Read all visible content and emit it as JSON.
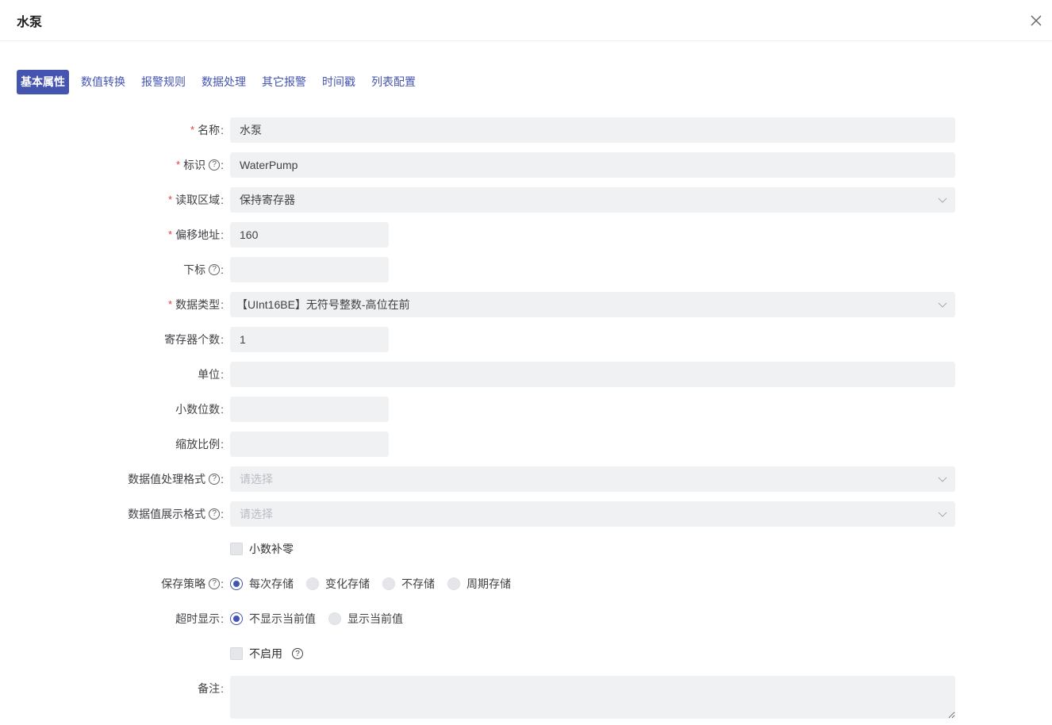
{
  "header": {
    "title": "水泵"
  },
  "tabs": [
    {
      "label": "基本属性",
      "active": true
    },
    {
      "label": "数值转换"
    },
    {
      "label": "报警规则"
    },
    {
      "label": "数据处理"
    },
    {
      "label": "其它报警"
    },
    {
      "label": "时间戳"
    },
    {
      "label": "列表配置"
    }
  ],
  "form": {
    "name": {
      "label": "名称",
      "value": "水泵"
    },
    "identifier": {
      "label": "标识",
      "value": "WaterPump"
    },
    "read_area": {
      "label": "读取区域",
      "value": "保持寄存器"
    },
    "offset": {
      "label": "偏移地址",
      "value": "160"
    },
    "index": {
      "label": "下标",
      "value": ""
    },
    "data_type": {
      "label": "数据类型",
      "value": "【UInt16BE】无符号整数-高位在前"
    },
    "register_count": {
      "label": "寄存器个数",
      "value": "1"
    },
    "unit": {
      "label": "单位",
      "value": ""
    },
    "decimals": {
      "label": "小数位数",
      "value": ""
    },
    "scale": {
      "label": "缩放比例",
      "value": ""
    },
    "process_format": {
      "label": "数据值处理格式",
      "placeholder": "请选择"
    },
    "display_format": {
      "label": "数据值展示格式",
      "placeholder": "请选择"
    },
    "zero_pad": {
      "label": "小数补零"
    },
    "save_strategy": {
      "label": "保存策略",
      "options": [
        "每次存储",
        "变化存储",
        "不存储",
        "周期存储"
      ]
    },
    "timeout_display": {
      "label": "超时显示",
      "options": [
        "不显示当前值",
        "显示当前值"
      ]
    },
    "disable": {
      "label": "不启用"
    },
    "remark": {
      "label": "备注",
      "value": ""
    }
  },
  "colors": {
    "accent": "#4554b0",
    "required": "#e53935",
    "input_bg": "#f0f1f3"
  }
}
